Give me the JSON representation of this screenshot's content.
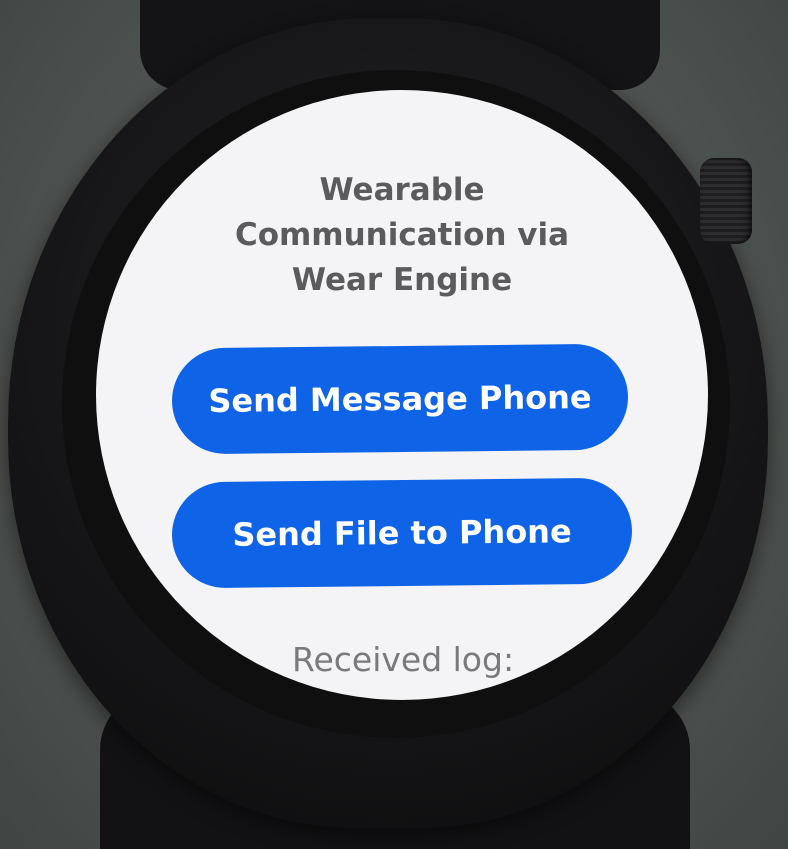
{
  "screen": {
    "title_lines": [
      "Wearable",
      "Communication via",
      "Wear Engine"
    ],
    "send_message_button": "Send Message Phone",
    "send_file_button": "Send File to Phone",
    "received_log_label": "Received log:"
  },
  "colors": {
    "button": "#0f63e6",
    "button_text": "#ffffff",
    "screen_background": "#f4f4f6",
    "title_text": "#5b5b5d",
    "log_text": "#7a7a7c"
  },
  "icons": {
    "crown": "digital-crown"
  }
}
